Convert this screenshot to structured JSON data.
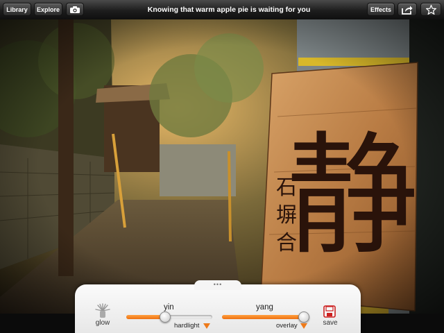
{
  "toolbar": {
    "library_label": "Library",
    "explore_label": "Explore",
    "camera_icon": "camera-icon",
    "title": "Knowing that warm apple pie is waiting for you",
    "effects_label": "Effects",
    "share_icon": "share-icon",
    "favorite_icon": "star-icon"
  },
  "photo": {
    "sign_large_kanji": "静",
    "sign_small_kanji": [
      "石",
      "塀",
      "合"
    ]
  },
  "panel": {
    "glow_label": "glow",
    "glow_icon": "glow-icon",
    "yin": {
      "label": "yin",
      "blend_label": "hardlight",
      "value": 0.45
    },
    "yang": {
      "label": "yang",
      "blend_label": "overlay",
      "value": 0.95
    },
    "save_label": "save",
    "save_icon": "save-icon",
    "colors": {
      "accent": "#ee7a1a",
      "panel": "#f2f2f2",
      "toolbar": "#1d1d1d"
    }
  }
}
